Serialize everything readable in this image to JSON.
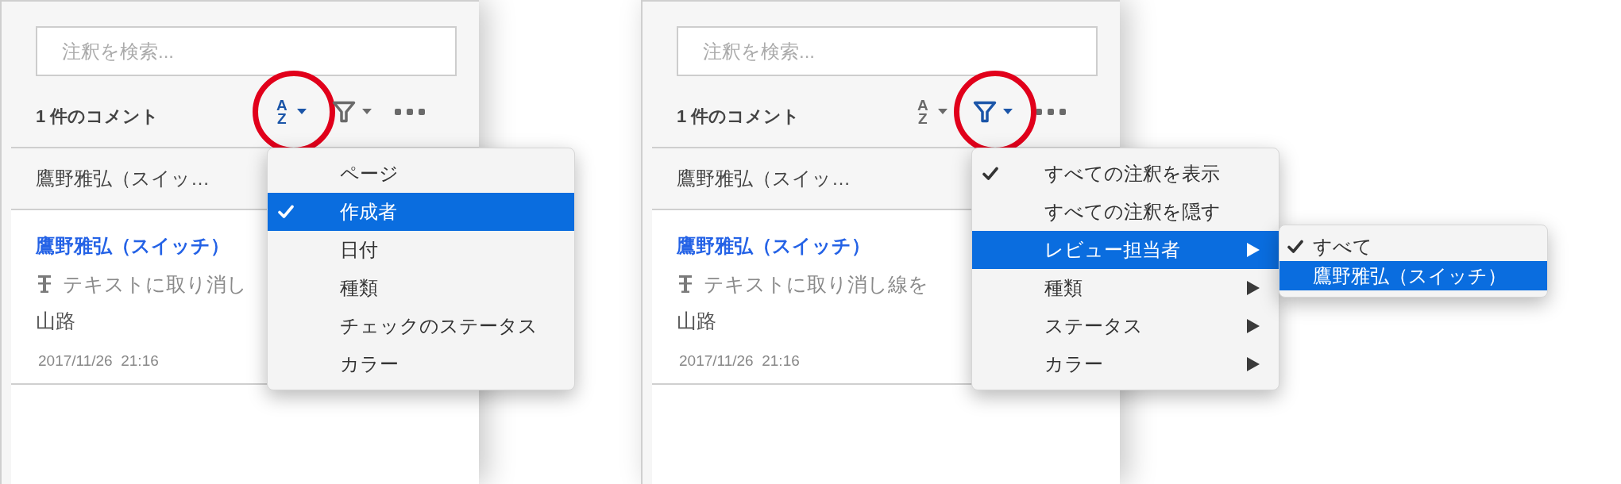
{
  "panels": [
    {
      "search": {
        "placeholder": "注釈を検索..."
      },
      "toolbar": {
        "count": "1 件のコメント",
        "tools": [
          {
            "kind": "sort",
            "glyph_top": "A",
            "glyph_bottom": "Z",
            "active": true
          },
          {
            "kind": "filter",
            "active": false
          },
          {
            "kind": "more"
          }
        ]
      },
      "author_row": {
        "label": "鷹野雅弘（スイッ…"
      },
      "comment": {
        "author": "鷹野雅弘（スイッチ）",
        "type_text": "テキストに取り消し",
        "body": "山路",
        "timestamp": "2017/11/26  21:16"
      },
      "menu": {
        "items": [
          {
            "label": "ページ",
            "checked": false,
            "selected": false
          },
          {
            "label": "作成者",
            "checked": true,
            "selected": true
          },
          {
            "label": "日付",
            "checked": false,
            "selected": false
          },
          {
            "label": "種類",
            "checked": false,
            "selected": false
          },
          {
            "label": "チェックのステータス",
            "checked": false,
            "selected": false
          },
          {
            "label": "カラー",
            "checked": false,
            "selected": false
          }
        ]
      }
    },
    {
      "search": {
        "placeholder": "注釈を検索..."
      },
      "toolbar": {
        "count": "1 件のコメント",
        "tools": [
          {
            "kind": "sort",
            "glyph_top": "A",
            "glyph_bottom": "Z",
            "active": false
          },
          {
            "kind": "filter",
            "active": true
          },
          {
            "kind": "more"
          }
        ]
      },
      "author_row": {
        "label": "鷹野雅弘（スイッ…"
      },
      "comment": {
        "author": "鷹野雅弘（スイッチ）",
        "type_text": "テキストに取り消し線を",
        "body": "山路",
        "timestamp": "2017/11/26  21:16"
      },
      "menu": {
        "items": [
          {
            "label": "すべての注釈を表示",
            "checked": true,
            "selected": false,
            "has_submenu": false
          },
          {
            "label": "すべての注釈を隠す",
            "checked": false,
            "selected": false,
            "has_submenu": false
          },
          {
            "label": "レビュー担当者",
            "checked": false,
            "selected": true,
            "has_submenu": true
          },
          {
            "label": "種類",
            "checked": false,
            "selected": false,
            "has_submenu": true
          },
          {
            "label": "ステータス",
            "checked": false,
            "selected": false,
            "has_submenu": true
          },
          {
            "label": "カラー",
            "checked": false,
            "selected": false,
            "has_submenu": true
          }
        ],
        "submenu": {
          "items": [
            {
              "label": "すべて",
              "checked": true,
              "selected": false
            },
            {
              "label": "鷹野雅弘（スイッチ）",
              "checked": false,
              "selected": true
            }
          ]
        }
      }
    }
  ]
}
